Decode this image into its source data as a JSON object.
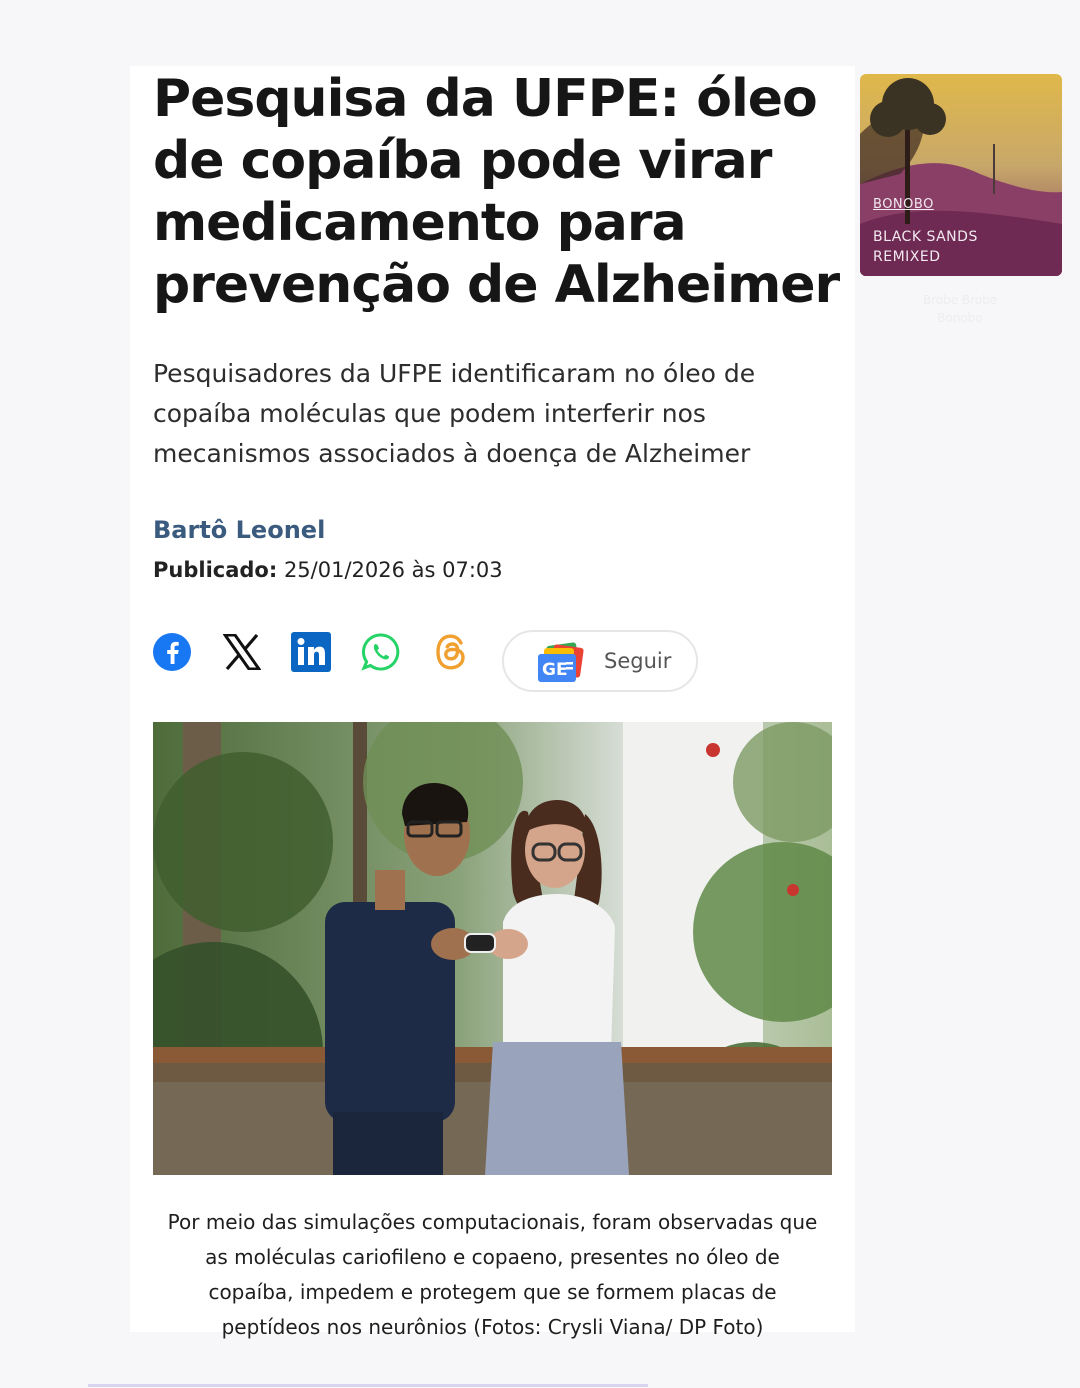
{
  "article": {
    "headline": "Pesquisa da UFPE: óleo de copaíba pode virar medicamento para prevenção de Alzheimer",
    "subtitle": "Pesquisadores da UFPE identificaram no óleo de copaíba moléculas que podem interferir nos mecanismos associados à doença de Alzheimer",
    "author": "Bartô Leonel",
    "published_label": "Publicado:",
    "published_value": "25/01/2026 às 07:03",
    "share_icons": [
      "facebook-icon",
      "x-icon",
      "linkedin-icon",
      "whatsapp-icon",
      "threads-icon"
    ],
    "follow_label": "Seguir",
    "follow_icon": "google-news-icon",
    "photo_caption": "Por meio das simulações computacionais, foram observadas que as moléculas cariofileno e copaeno, presentes no óleo de copaíba, impedem e protegem que se formem placas de peptídeos nos neurônios (Fotos: Crysli Viana/ DP Foto)"
  },
  "music_sticker": {
    "album_artist": "BONOBO",
    "album_title": "BLACK SANDS REMIXED",
    "track_line": "Brobe Brobe Bonobo"
  },
  "colors": {
    "author": "#3a5a7e",
    "facebook": "#1877f2",
    "linkedin": "#0a66c2",
    "whatsapp": "#25d366",
    "threads": "#f0a030"
  }
}
